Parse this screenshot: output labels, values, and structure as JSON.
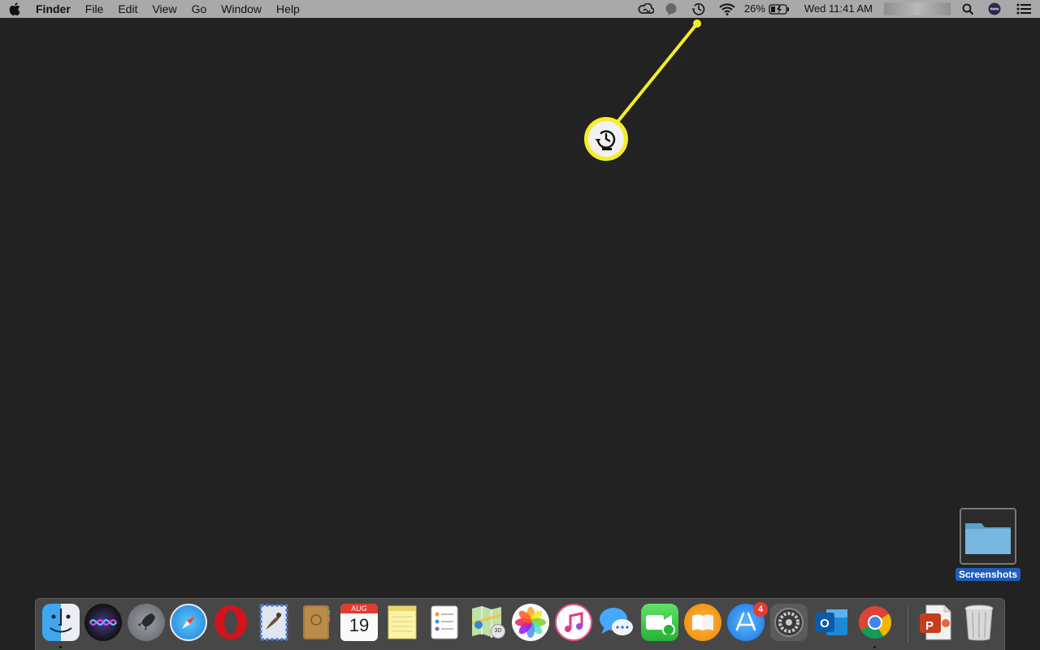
{
  "menubar": {
    "app_name": "Finder",
    "menus": [
      "File",
      "Edit",
      "View",
      "Go",
      "Window",
      "Help"
    ],
    "battery_percent": "26%",
    "clock": "Wed 11:41 AM",
    "status_icons": [
      "creative-cloud-icon",
      "notification-icon",
      "time-machine-icon",
      "wifi-icon",
      "battery-charging-icon",
      "search-icon",
      "siri-icon",
      "notification-center-icon"
    ]
  },
  "callout": {
    "color": "#f5ed2a",
    "icon": "time-machine-icon"
  },
  "desktop": {
    "folder_label": "Screenshots"
  },
  "dock": {
    "items": [
      {
        "name": "Finder",
        "icon": "finder-icon",
        "running": true
      },
      {
        "name": "Siri",
        "icon": "siri-icon",
        "running": false
      },
      {
        "name": "Launchpad",
        "icon": "launchpad-icon",
        "running": false
      },
      {
        "name": "Safari",
        "icon": "safari-icon",
        "running": false
      },
      {
        "name": "Opera",
        "icon": "opera-icon",
        "running": false
      },
      {
        "name": "Mail",
        "icon": "mail-icon",
        "running": false
      },
      {
        "name": "Contacts",
        "icon": "contacts-icon",
        "running": false
      },
      {
        "name": "Calendar",
        "icon": "calendar-icon",
        "running": false
      },
      {
        "name": "Notes",
        "icon": "notes-icon",
        "running": false
      },
      {
        "name": "Reminders",
        "icon": "reminders-icon",
        "running": false
      },
      {
        "name": "Maps",
        "icon": "maps-icon",
        "running": false
      },
      {
        "name": "Photos",
        "icon": "photos-icon",
        "running": false
      },
      {
        "name": "iTunes",
        "icon": "itunes-icon",
        "running": false
      },
      {
        "name": "Messages",
        "icon": "messages-icon",
        "running": false
      },
      {
        "name": "FaceTime",
        "icon": "facetime-icon",
        "running": false
      },
      {
        "name": "iBooks",
        "icon": "ibooks-icon",
        "running": false
      },
      {
        "name": "App Store",
        "icon": "app-store-icon",
        "running": false
      },
      {
        "name": "System Preferences",
        "icon": "system-preferences-icon",
        "running": false
      },
      {
        "name": "Outlook",
        "icon": "outlook-icon",
        "running": false
      },
      {
        "name": "Chrome",
        "icon": "chrome-icon",
        "running": true
      },
      {
        "name": "PowerPoint document",
        "icon": "powerpoint-doc-icon",
        "running": false
      },
      {
        "name": "Trash",
        "icon": "trash-icon",
        "running": false
      }
    ],
    "calendar_month": "AUG",
    "calendar_day": "19",
    "app_store_badge": "4",
    "maps_badge": "3D",
    "outlook_letter": "O",
    "powerpoint_letter": "P"
  }
}
